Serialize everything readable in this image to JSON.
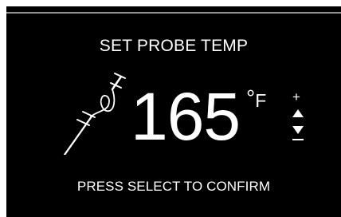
{
  "screen": {
    "title": "SET PROBE TEMP",
    "temperature_value": "165",
    "degree_symbol": "°",
    "unit": "F",
    "increase_label": "+",
    "footer_text": "PRESS SELECT TO CONFIRM"
  },
  "icons": {
    "probe": "temperature-probe-icon",
    "up": "triangle-up-icon",
    "down": "triangle-down-icon"
  },
  "colors": {
    "background": "#000000",
    "text": "#ffffff",
    "divider": "#8f8f8f"
  }
}
